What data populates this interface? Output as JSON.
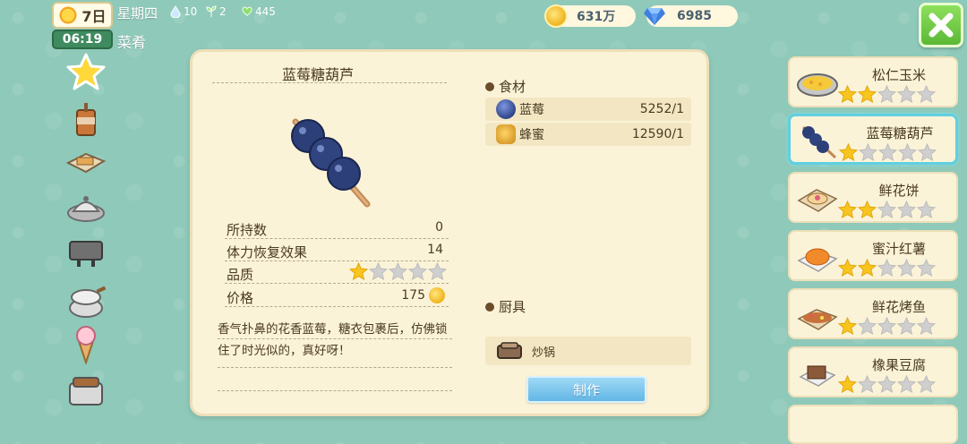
{
  "status": {
    "day": "7日",
    "time": "06:19",
    "weekday": "星期四",
    "stat_1": "10",
    "stat_2": "2",
    "stat_3": "445",
    "section_title": "菜肴"
  },
  "currency": {
    "gold": "631万",
    "gems": "6985"
  },
  "tabs": [
    "star-tab-icon",
    "drink-tab-icon",
    "bread-tab-icon",
    "pot-tab-icon",
    "grill-tab-icon",
    "steamer-tab-icon",
    "icecream-tab-icon",
    "oven-tab-icon"
  ],
  "detail": {
    "title": "蓝莓糖葫芦",
    "rows": [
      {
        "label": "所持数",
        "value": "0"
      },
      {
        "label": "体力恢复效果",
        "value": "14"
      },
      {
        "label": "品质",
        "stars": 1
      },
      {
        "label": "价格",
        "value": "175"
      }
    ],
    "description": "香气扑鼻的花香蓝莓，糖衣包裹后，仿佛锁住了时光似的，真好呀！"
  },
  "ingredients_header": "食材",
  "ingredients": [
    {
      "name": "蓝莓",
      "qty": "5252/1",
      "icon": "blueberry-icon"
    },
    {
      "name": "蜂蜜",
      "qty": "12590/1",
      "icon": "honey-icon"
    }
  ],
  "tools_header": "厨具",
  "tool": {
    "name": "炒锅",
    "icon": "wok-icon"
  },
  "make_label": "制作",
  "recipes": [
    {
      "name": "松仁玉米",
      "stars": 2
    },
    {
      "name": "蓝莓糖葫芦",
      "stars": 1,
      "selected": true
    },
    {
      "name": "鲜花饼",
      "stars": 2
    },
    {
      "name": "蜜汁红薯",
      "stars": 2
    },
    {
      "name": "鲜花烤鱼",
      "stars": 1
    },
    {
      "name": "橡果豆腐",
      "stars": 1
    }
  ],
  "colors": {
    "background": "#8fc9b9",
    "panel": "#fbf3d8",
    "star_on": "#f7c51e",
    "star_off": "#cfcfcf",
    "make_button": "#62b6e6",
    "close_button": "#5cb836"
  }
}
